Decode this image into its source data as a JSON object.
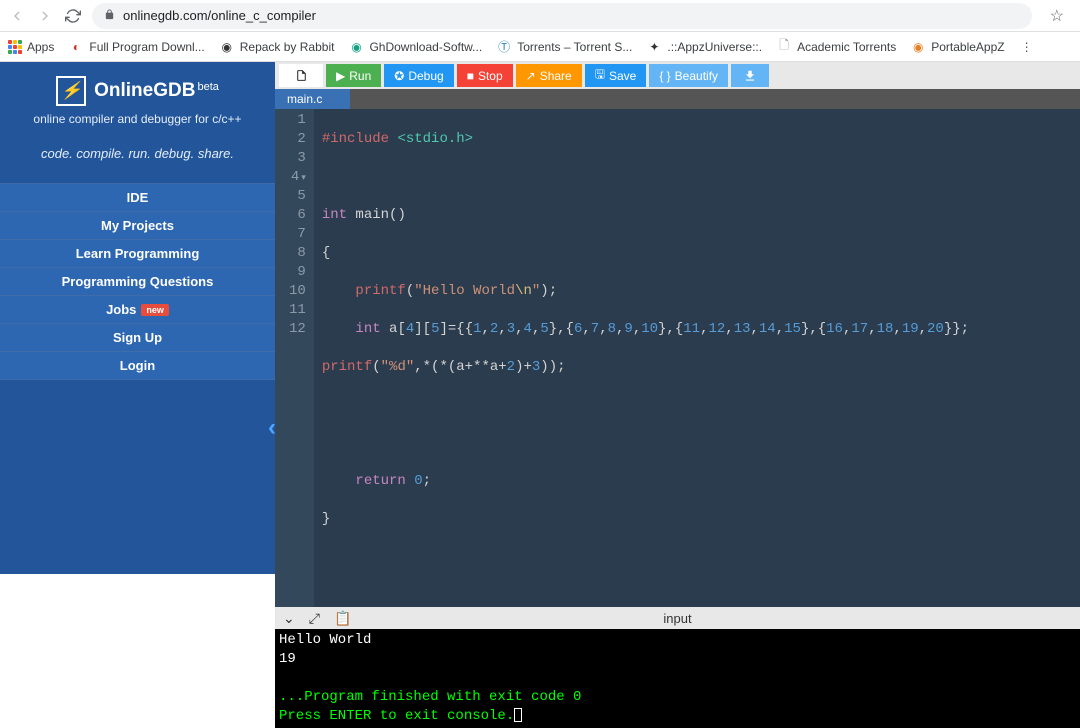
{
  "browser": {
    "url": "onlinegdb.com/online_c_compiler"
  },
  "bookmarks": {
    "apps": "Apps",
    "items": [
      "Full Program Downl...",
      "Repack by Rabbit",
      "GhDownload-Softw...",
      "Torrents – Torrent S...",
      ".::AppzUniverse::.",
      "Academic Torrents",
      "PortableAppZ"
    ]
  },
  "sidebar": {
    "title": "OnlineGDB",
    "beta": "beta",
    "tagline1": "online compiler and debugger for c/c++",
    "tagline2": "code. compile. run. debug. share.",
    "items": [
      "IDE",
      "My Projects",
      "Learn Programming",
      "Programming Questions",
      "Jobs",
      "Sign Up",
      "Login"
    ],
    "new_badge": "new"
  },
  "toolbar": {
    "run": "Run",
    "debug": "Debug",
    "stop": "Stop",
    "share": "Share",
    "save": "Save",
    "beautify": "Beautify"
  },
  "tab": {
    "name": "main.c"
  },
  "editor": {
    "line_count": 12
  },
  "console_bar": {
    "input_label": "input"
  },
  "console": {
    "out1": "Hello World",
    "out2": "19",
    "done1": "...Program finished with exit code 0",
    "done2": "Press ENTER to exit console."
  }
}
